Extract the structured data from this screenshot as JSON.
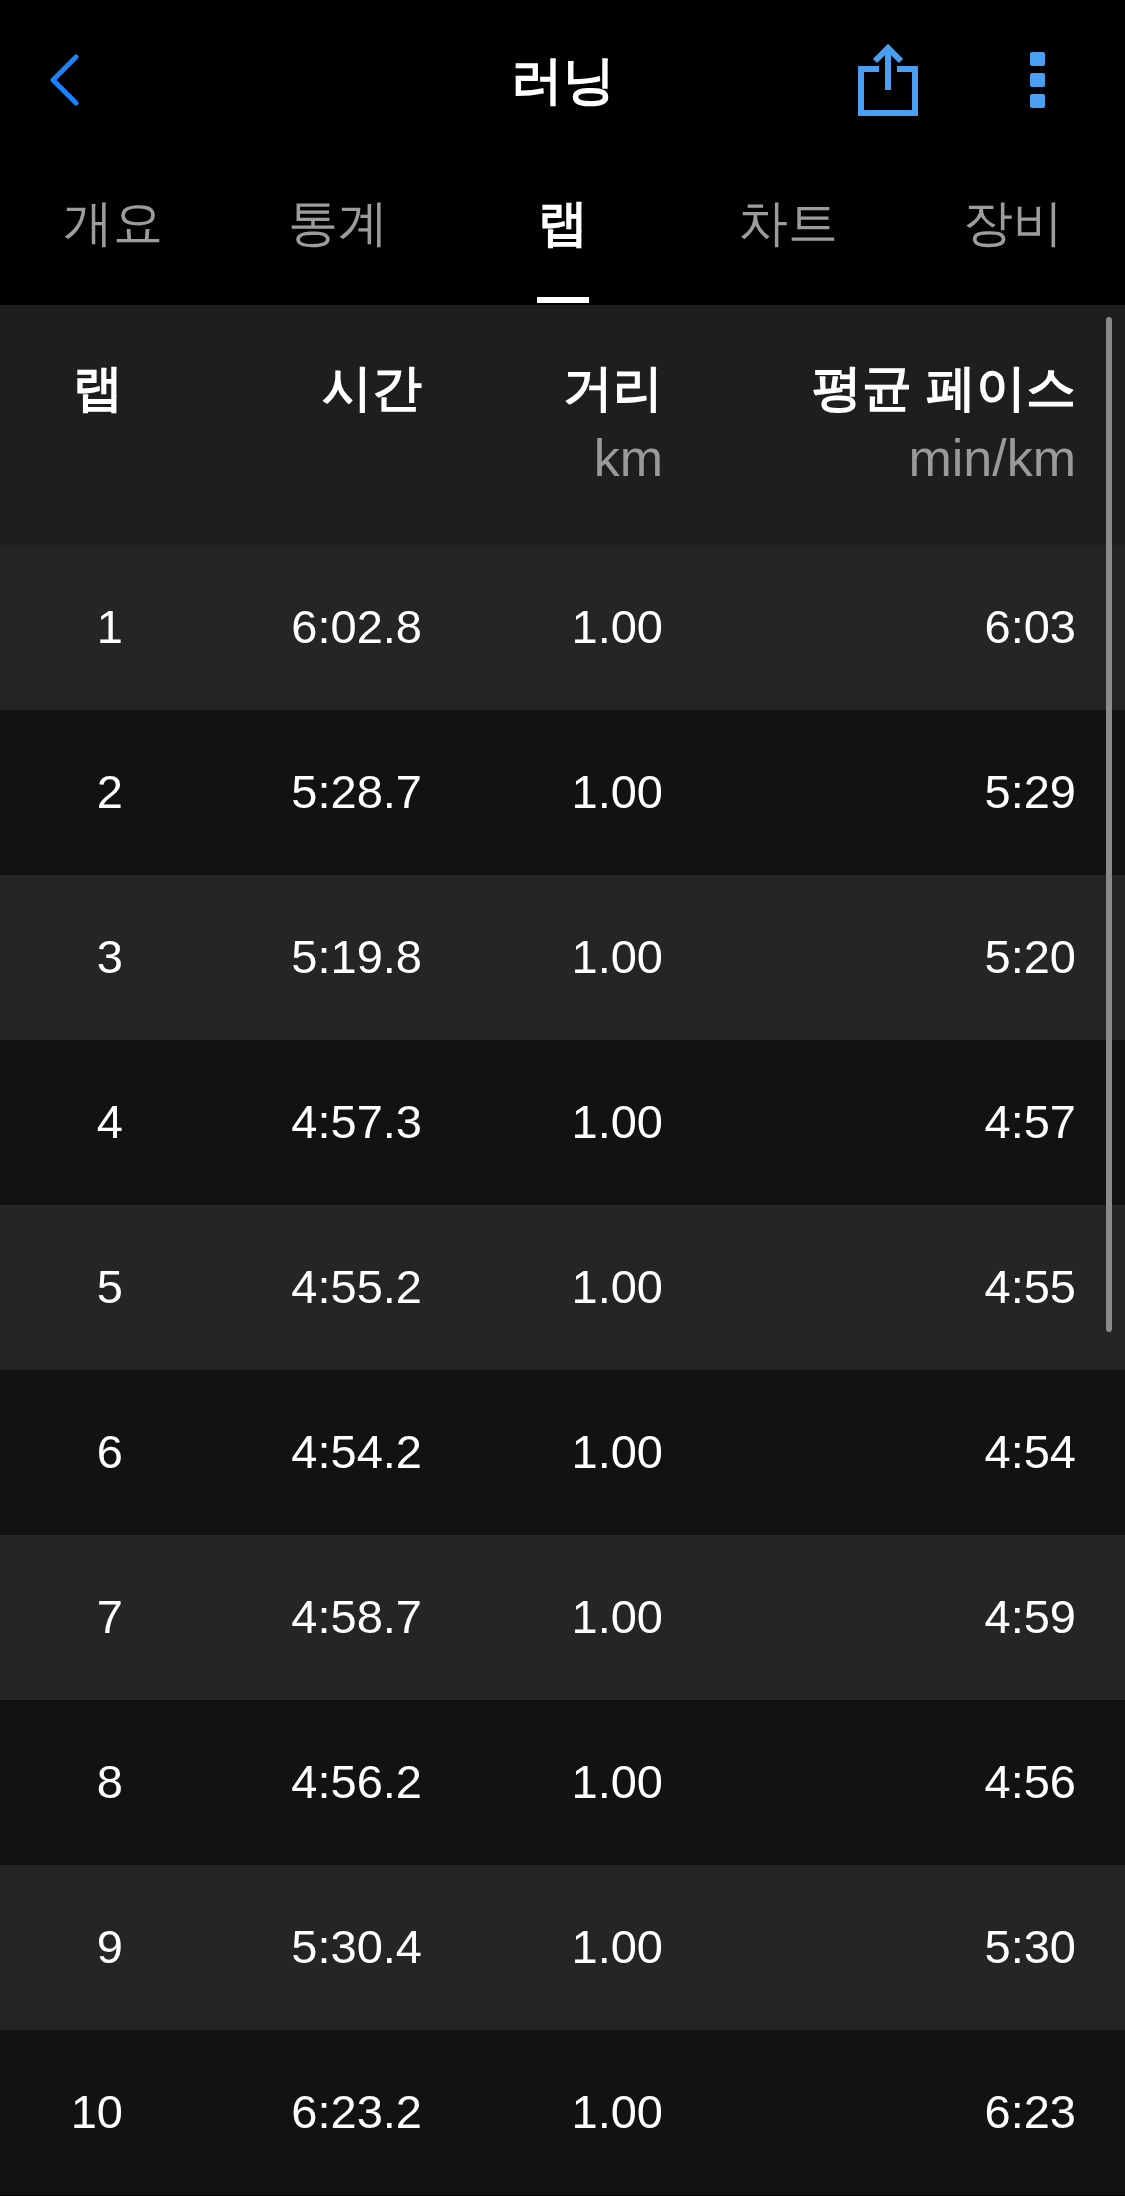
{
  "top_bar": {
    "title": "러닝"
  },
  "tabs": [
    {
      "label": "개요",
      "selected": false
    },
    {
      "label": "통계",
      "selected": false
    },
    {
      "label": "랩",
      "selected": true
    },
    {
      "label": "차트",
      "selected": false
    },
    {
      "label": "장비",
      "selected": false
    }
  ],
  "table": {
    "columns": [
      {
        "label": "랩"
      },
      {
        "label": "시간"
      },
      {
        "label": "거리",
        "unit": "km"
      },
      {
        "label": "평균 페이스",
        "unit": "min/km"
      }
    ],
    "rows": [
      [
        "1",
        "6:02.8",
        "1.00",
        "6:03"
      ],
      [
        "2",
        "5:28.7",
        "1.00",
        "5:29"
      ],
      [
        "3",
        "5:19.8",
        "1.00",
        "5:20"
      ],
      [
        "4",
        "4:57.3",
        "1.00",
        "4:57"
      ],
      [
        "5",
        "4:55.2",
        "1.00",
        "4:55"
      ],
      [
        "6",
        "4:54.2",
        "1.00",
        "4:54"
      ],
      [
        "7",
        "4:58.7",
        "1.00",
        "4:59"
      ],
      [
        "8",
        "4:56.2",
        "1.00",
        "4:56"
      ],
      [
        "9",
        "5:30.4",
        "1.00",
        "5:30"
      ],
      [
        "10",
        "6:23.2",
        "1.00",
        "6:23"
      ]
    ]
  }
}
